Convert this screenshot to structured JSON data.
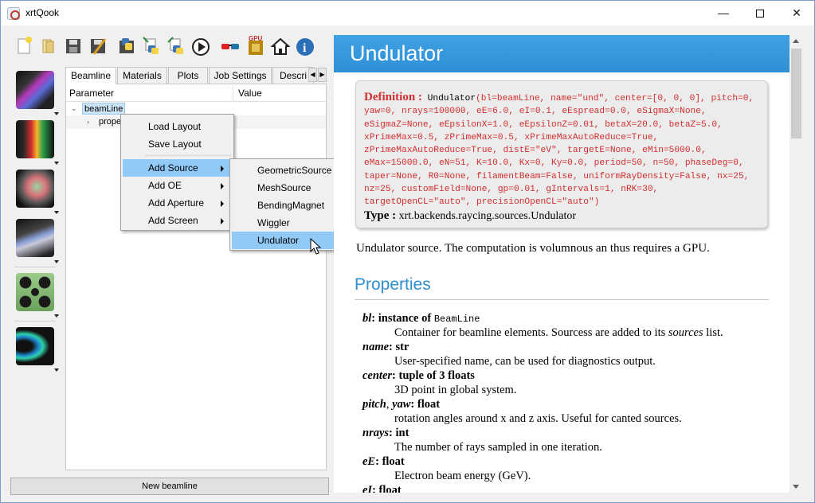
{
  "window": {
    "title": "xrtQook",
    "minimize": "—",
    "close": "✕"
  },
  "toolbar": {
    "icons": [
      "new-file-icon",
      "open-folder-icon",
      "save-icon",
      "save-as-icon",
      "generate-python-icon",
      "save-python-icon",
      "save-python-as-icon",
      "run-icon",
      "glow-3d-icon",
      "gpu-icon",
      "home-icon",
      "info-icon"
    ],
    "gpu_label": "GPU"
  },
  "side_buttons": [
    "sources-button",
    "optical-elements-button",
    "apertures-button",
    "screens-button",
    "materials-button",
    "plots-button"
  ],
  "tabs": [
    "Beamline",
    "Materials",
    "Plots",
    "Job Settings",
    "Descri"
  ],
  "tree": {
    "col_parameter": "Parameter",
    "col_value": "Value",
    "root": "beamLine",
    "child": "prope"
  },
  "new_beamline_button": "New beamline",
  "context_menu": {
    "items": [
      "Load Layout",
      "Save Layout",
      "Add Source",
      "Add OE",
      "Add Aperture",
      "Add Screen"
    ]
  },
  "submenu": {
    "items": [
      "GeometricSource",
      "MeshSource",
      "BendingMagnet",
      "Wiggler",
      "Undulator"
    ]
  },
  "doc": {
    "title": "Undulator",
    "definition_label": "Definition :",
    "definition_name": "Undulator",
    "definition_args": "(bl=beamLine, name=\"und\", center=[0, 0, 0], pitch=0, yaw=0, nrays=100000, eE=6.0, eI=0.1, eEspread=0.0, eSigmaX=None, eSigmaZ=None, eEpsilonX=1.0, eEpsilonZ=0.01, betaX=20.0, betaZ=5.0, xPrimeMax=0.5, zPrimeMax=0.5, xPrimeMaxAutoReduce=True, zPrimeMaxAutoReduce=True, distE=\"eV\", targetE=None, eMin=5000.0, eMax=15000.0, eN=51, K=10.0, Kx=0, Ky=0.0, period=50, n=50, phaseDeg=0, taper=None, R0=None, filamentBeam=False, uniformRayDensity=False, nx=25, nz=25, customField=None, gp=0.01, gIntervals=1, nRK=30, targetOpenCL=\"auto\", precisionOpenCL=\"auto\")",
    "type_label": "Type :",
    "type_value": "xrt.backends.raycing.sources.Undulator",
    "description": "Undulator source. The computation is volumnous an thus requires a GPU.",
    "properties_title": "Properties",
    "properties": [
      {
        "name": "bl",
        "sep": ": ",
        "type_prefix": "instance of ",
        "type_mono": "BeamLine",
        "type": "",
        "desc_pre": "Container for beamline elements. Sourcess are added to its ",
        "desc_em": "sources",
        "desc_post": " list."
      },
      {
        "name": "name",
        "sep": ": ",
        "type_prefix": "",
        "type_mono": "",
        "type": "str",
        "desc_pre": "User-specified name, can be used for diagnostics output.",
        "desc_em": "",
        "desc_post": ""
      },
      {
        "name": "center",
        "sep": ": ",
        "type_prefix": "",
        "type_mono": "",
        "type": "tuple of 3 floats",
        "desc_pre": "3D point in global system.",
        "desc_em": "",
        "desc_post": ""
      },
      {
        "name": "pitch, yaw",
        "sep": ": ",
        "type_prefix": "",
        "type_mono": "",
        "type": "float",
        "desc_pre": "rotation angles around x and z axis. Useful for canted sources.",
        "desc_em": "",
        "desc_post": ""
      },
      {
        "name": "nrays",
        "sep": ": ",
        "type_prefix": "",
        "type_mono": "",
        "type": "int",
        "desc_pre": "The number of rays sampled in one iteration.",
        "desc_em": "",
        "desc_post": ""
      },
      {
        "name": "eE",
        "sep": ": ",
        "type_prefix": "",
        "type_mono": "",
        "type": "float",
        "desc_pre": "Electron beam energy (GeV).",
        "desc_em": "",
        "desc_post": ""
      },
      {
        "name": "eI",
        "sep": ": ",
        "type_prefix": "",
        "type_mono": "",
        "type": "float",
        "desc_pre": "",
        "desc_em": "",
        "desc_post": ""
      }
    ]
  }
}
